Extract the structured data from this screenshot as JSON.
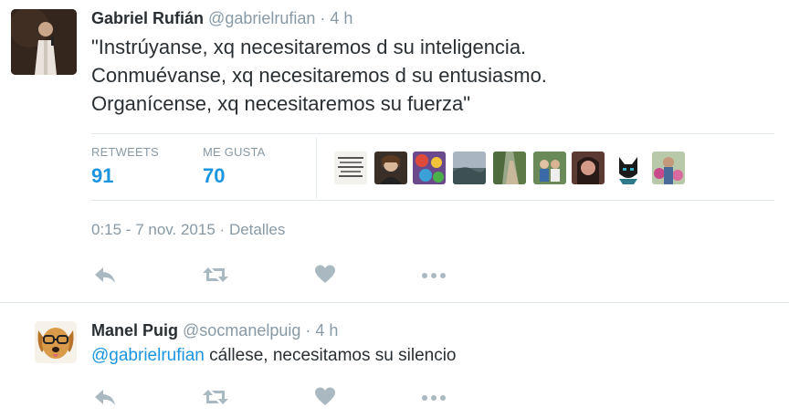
{
  "main_tweet": {
    "author_name": "Gabriel Rufián",
    "author_handle": "@gabrielrufian",
    "separator": "·",
    "time_ago": "4 h",
    "text_lines": [
      "\"Instrúyanse, xq necesitaremos d su inteligencia.",
      "Conmuévanse, xq necesitaremos d su entusiasmo.",
      "Organícense, xq necesitaremos su fuerza\""
    ],
    "stats": {
      "retweets_label": "RETWEETS",
      "retweets_value": "91",
      "likes_label": "ME GUSTA",
      "likes_value": "70"
    },
    "timestamp": "0:15 - 7 nov. 2015",
    "details_link": "Detalles"
  },
  "reply_tweet": {
    "author_name": "Manel Puig",
    "author_handle": "@socmanelpuig",
    "separator": "·",
    "time_ago": "4 h",
    "mention": "@gabrielrufian",
    "text": " cállese, necesitamos su silencio"
  },
  "icons": {
    "reply": "reply-icon",
    "retweet": "retweet-icon",
    "like": "heart-icon",
    "more": "more-dots-icon"
  },
  "colors": {
    "link_blue": "#1b95e0",
    "muted_gray": "#8899a6",
    "text_dark": "#292f33",
    "icon_gray": "#aab8c2",
    "divider": "#e1e8ed"
  }
}
